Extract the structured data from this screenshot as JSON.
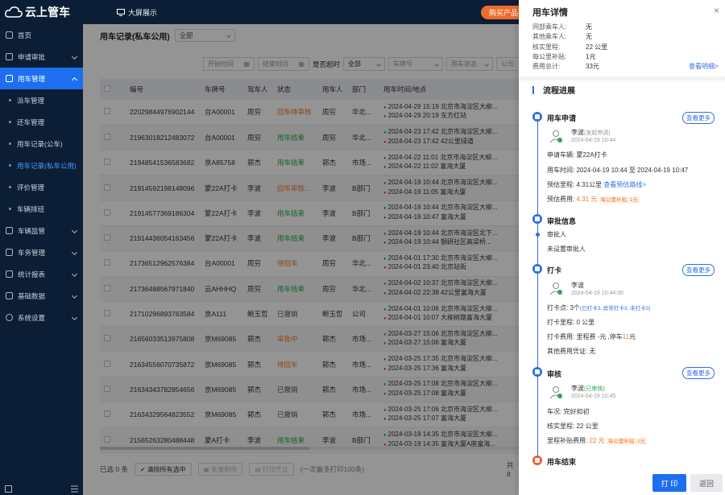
{
  "topbar": {
    "logo_text": "云上管车",
    "bigscreen_label": "大屏展示",
    "buy_label": "购买产品"
  },
  "sidebar": {
    "items": [
      {
        "label": "首页"
      },
      {
        "label": "申请审批"
      },
      {
        "label": "用车管理"
      },
      {
        "label": "派车管理"
      },
      {
        "label": "还车管理"
      },
      {
        "label": "用车记录(公车)"
      },
      {
        "label": "用车记录(私车公用)"
      },
      {
        "label": "评价管理"
      },
      {
        "label": "车辆排班"
      },
      {
        "label": "车辆监管"
      },
      {
        "label": "车务管理"
      },
      {
        "label": "统计报表"
      },
      {
        "label": "基础数据"
      },
      {
        "label": "系统设置"
      }
    ]
  },
  "main": {
    "title": "用车记录(私车公用)",
    "scope_select": "全部",
    "filters": {
      "start_time": "开始时间",
      "end_time": "结束时间",
      "overtime_label": "是否超时",
      "overtime_value": "全部",
      "plate": "车牌号",
      "car_status": "用车状态",
      "company": "公司"
    },
    "table": {
      "headers": [
        "",
        "编号",
        "车牌号",
        "驾车人",
        "状态",
        "用车人",
        "部门",
        "用车时间/地点"
      ],
      "rows": [
        {
          "id": "22029844976902144",
          "plate": "台A00001",
          "driver": "周穷",
          "status": "回车待审核",
          "status_class": "st-orange",
          "user": "周穷",
          "dept": "华北...",
          "t1": "2024-04-29 15:19 北京市海淀区大柳...",
          "t2": "2024-04-29 20:19 东方红站"
        },
        {
          "id": "21963018212483072",
          "plate": "台A00001",
          "driver": "周穷",
          "status": "用车结束",
          "status_class": "st-green",
          "user": "周穷",
          "dept": "华北...",
          "t1": "2024-04-23 17:42 北京市海淀区大柳...",
          "t2": "2024-04-23 17:42 42公里绿道"
        },
        {
          "id": "21948541536583682",
          "plate": "京A85758",
          "driver": "郭杰",
          "status": "用车结束",
          "status_class": "st-green",
          "user": "郭杰",
          "dept": "市场...",
          "t1": "2024-04-22 11:01 北京市海淀区大柳...",
          "t2": "2024-04-22 11:02 富海大厦"
        },
        {
          "id": "21914592198148096",
          "plate": "蒙22A打卡",
          "driver": "李波",
          "status": "回车审核...",
          "status_class": "st-orange",
          "user": "李波",
          "dept": "B部门",
          "t1": "2024-04-19 10:44 北京市海淀区大柳...",
          "t2": "2024-04-19 11:05 富海大厦"
        },
        {
          "id": "21914577369186304",
          "plate": "蒙22A打卡",
          "driver": "李波",
          "status": "用车结束",
          "status_class": "st-green",
          "user": "李波",
          "dept": "B部门",
          "t1": "2024-04-19 10:44 北京市海淀区大柳...",
          "t2": "2024-04-19 10:47 富海大厦"
        },
        {
          "id": "21914436054163456",
          "plate": "蒙22A打卡",
          "driver": "李波",
          "status": "用车结束",
          "status_class": "st-green",
          "user": "李波",
          "dept": "B部门",
          "t1": "2024-04-19 10:44 北京市海淀区北下...",
          "t2": "2024-04-19 10:44 钢研社区高梁桥..."
        },
        {
          "id": "21736512962576384",
          "plate": "台A00001",
          "driver": "周穷",
          "status": "待回车",
          "status_class": "st-orange",
          "user": "周穷",
          "dept": "华北...",
          "t1": "2024-04-01 17:30 北京市海淀区大柳...",
          "t2": "2024-04-01 23:40 北京站街"
        },
        {
          "id": "21736488567971840",
          "plate": "云AHHHQ",
          "driver": "周穷",
          "status": "用车结束",
          "status_class": "st-green",
          "user": "周穷",
          "dept": "华北...",
          "t1": "2024-04-02 10:37 北京市海淀区大柳...",
          "t2": "2024-04-02 22:38 42公里富海大厦"
        },
        {
          "id": "21710296893763584",
          "plate": "京A111",
          "driver": "鲍玉哲",
          "status": "已撤销",
          "status_class": "st-gray",
          "user": "鲍玉哲",
          "dept": "公司",
          "t1": "2024-04-01 10:06 北京市海淀区大柳...",
          "t2": "2024-04-01 10:07 大柳树路富海大厦"
        },
        {
          "id": "21656033513975808",
          "plate": "京M69085",
          "driver": "郭杰",
          "status": "审批中",
          "status_class": "st-orange",
          "user": "郭杰",
          "dept": "市场...",
          "t1": "2024-03-27 15:06 北京市海淀区大柳...",
          "t2": "2024-03-27 15:06 富海大厦"
        },
        {
          "id": "21634556070735872",
          "plate": "京M69085",
          "driver": "郭杰",
          "status": "待回车",
          "status_class": "st-orange",
          "user": "郭杰",
          "dept": "市场...",
          "t1": "2024-03-25 17:35 北京市海淀区大柳...",
          "t2": "2024-03-25 17:36 富海大厦"
        },
        {
          "id": "21634343782854656",
          "plate": "京M69085",
          "driver": "郭杰",
          "status": "已撤销",
          "status_class": "st-gray",
          "user": "郭杰",
          "dept": "市场...",
          "t1": "2024-03-25 17:08 北京市海淀区大柳...",
          "t2": "2024-03-25 17:08 富海大厦"
        },
        {
          "id": "21634329564823552",
          "plate": "京M69085",
          "driver": "郭杰",
          "status": "已撤销",
          "status_class": "st-gray",
          "user": "郭杰",
          "dept": "市场...",
          "t1": "2024-03-25 17:06 北京市海淀区大柳...",
          "t2": "2024-03-25 17:07 富海大厦"
        },
        {
          "id": "21565263280488448",
          "plate": "蒙A打卡",
          "driver": "李波",
          "status": "用车结束",
          "status_class": "st-green",
          "user": "李波",
          "dept": "B部门",
          "t1": "2024-03-19 14:35 北京市海淀区大柳...",
          "t2": "2024-03-19 14:35 富海大厦A座富海..."
        }
      ]
    },
    "footer": {
      "selected": "已选 0 条",
      "clear_label": "清除所有选中",
      "batch_delete": "批量删除",
      "print_voucher": "打印凭证",
      "print_hint": "(一次最多打印100条)",
      "total_prefix": "共 8"
    }
  },
  "panel": {
    "title": "用车详情",
    "info": [
      {
        "k": "同部乘车人:",
        "v": "无"
      },
      {
        "k": "其他乘车人:",
        "v": "无"
      },
      {
        "k": "核实里程:",
        "v": "22 公里"
      },
      {
        "k": "每公里补贴:",
        "v": "1元"
      },
      {
        "k": "费用总计:",
        "v": "33元"
      }
    ],
    "detail_link": "查看明细>",
    "flow_title": "流程进展",
    "sections": {
      "apply": {
        "title": "用车申请",
        "more": "查看更多",
        "person": "李波",
        "person_sub": "(发起申请)",
        "time": "2024-04-19 10:44",
        "vehicle": "申请车辆:  蒙22A打卡",
        "use_time": "用车时间:  2024-04-19 10:44 至 2024-04-19 10:47",
        "mileage": "预估里程:  4.31公里",
        "route_link": "查看预估路线>",
        "fee_label": "预估费用:",
        "fee_value": "4.31 元",
        "fee_tag": "每公里补贴: 1元"
      },
      "approve": {
        "title": "审批信息",
        "approver_label": "审批人",
        "approver_value": "未设置审批人"
      },
      "checkin": {
        "title": "打卡",
        "more": "查看更多",
        "person": "李波",
        "time": "2024-04-19 10:44:00",
        "points_label": "打卡点:  3个",
        "points_detail": "(已打卡3, 异常打卡3, 未打卡0)",
        "mileage": "打卡里程:   0 公里",
        "fee_prefix": "打卡费用:  里程费 -元 ,停车",
        "fee_value": "11",
        "fee_suffix": "元",
        "other": "其他费用凭证:  无"
      },
      "review": {
        "title": "审核",
        "more": "查看更多",
        "person": "李波",
        "person_sub": "(已审核)",
        "time": "2024-04-19 10:45",
        "condition": "车况:  完好如初",
        "mileage": "核实里程:   22 公里",
        "fee_label": "里程补贴费用:",
        "fee_value": "22 元",
        "fee_tag": "每公里补贴: 1元"
      },
      "end": {
        "title": "用车结束"
      }
    },
    "print_label": "打 印",
    "back_label": "返回"
  },
  "colors": {
    "primary": "#1d6ff0",
    "sidebar_bg": "#0c1e35",
    "orange": "#f07a2a",
    "green": "#2aa84a"
  }
}
